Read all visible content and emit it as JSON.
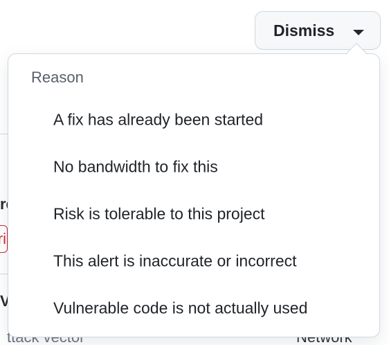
{
  "dismiss_button": {
    "label": "Dismiss"
  },
  "dropdown": {
    "header": "Reason",
    "items": [
      {
        "label": "A fix has already been started"
      },
      {
        "label": "No bandwidth to fix this"
      },
      {
        "label": "Risk is tolerable to this project"
      },
      {
        "label": "This alert is inaccurate or incorrect"
      },
      {
        "label": "Vulnerable code is not actually used"
      }
    ]
  },
  "background": {
    "fragment_1": "re",
    "badge_fragment": "ri",
    "fragment_2": "V",
    "fragment_3": "ttack vector",
    "fragment_4": "Network"
  },
  "colors": {
    "button_bg": "#f6f8fa",
    "border": "#d0d7de",
    "text": "#1f2328",
    "muted_text": "#57606a",
    "danger": "#cf222e"
  }
}
